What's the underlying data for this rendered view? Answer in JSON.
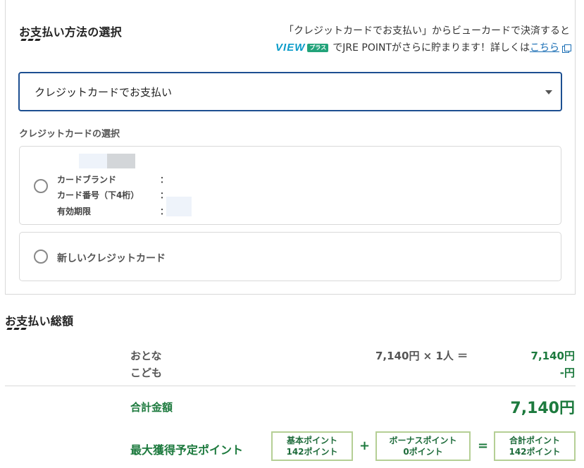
{
  "payment_section": {
    "title": "お支払い方法の選択",
    "promo_line1": "「クレジットカードでお支払い」からビューカードで決済すると",
    "promo_logo": "VIEW",
    "promo_badge": "プラス",
    "promo_line2": "でJRE POINTがさらに貯まります！詳しくは",
    "promo_link": "こちら",
    "selected_method": "クレジットカードでお支払い",
    "card_select_label": "クレジットカードの選択",
    "saved_card": {
      "brand_label": "カードブランド",
      "number_label": "カード番号（下4桁）",
      "expiry_label": "有効期限",
      "colon": "："
    },
    "new_card_label": "新しいクレジットカード"
  },
  "total_section": {
    "title": "お支払い総額",
    "adult_label": "おとな",
    "adult_calc": "7,140円 × 1人 ＝",
    "adult_amount": "7,140円",
    "child_label": "こども",
    "child_amount": "-円",
    "sum_label": "合計金額",
    "sum_amount": "7,140円",
    "points_label": "最大獲得予定ポイント",
    "base_points_label": "基本ポイント",
    "base_points_value": "142ポイント",
    "plus_sign": "+",
    "bonus_points_label": "ボーナスポイント",
    "bonus_points_value": "0ポイント",
    "equals_sign": "=",
    "total_points_label": "合計ポイント",
    "total_points_value": "142ポイント"
  },
  "colors": {
    "accent_border": "#1d4f91",
    "green_text": "#1d7a3e",
    "point_box_border": "#b5cf95",
    "link": "#1b6fb5"
  }
}
